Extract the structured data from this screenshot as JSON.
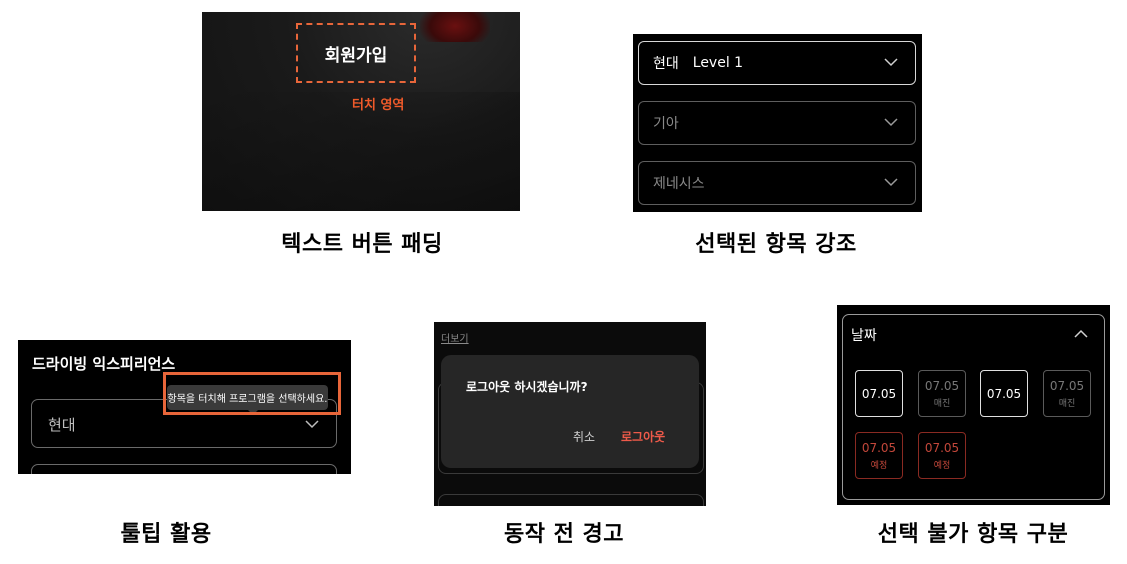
{
  "captions": {
    "text_button_padding": "텍스트 버튼 패딩",
    "selected_item_emphasis": "선택된 항목 강조",
    "tooltip_usage": "툴팁 활용",
    "pre_action_warning": "동작 전 경고",
    "unavailable_item_distinction": "선택 불가 항목 구분"
  },
  "panel_signup": {
    "button_label": "회원가입",
    "touch_area_label": "터치 영역"
  },
  "panel_dropdowns": {
    "items": [
      {
        "label": "현대",
        "sub": "Level 1"
      },
      {
        "label": "기아",
        "sub": ""
      },
      {
        "label": "제네시스",
        "sub": ""
      }
    ]
  },
  "panel_tooltip": {
    "title": "드라이빙 익스피리언스",
    "tooltip_text": "항목을 터치해 프로그램을 선택하세요.",
    "field_value": "현대"
  },
  "panel_dialog": {
    "more_link": "더보기",
    "message": "로그아웃 하시겠습니까?",
    "cancel_label": "취소",
    "logout_label": "로그아웃"
  },
  "panel_dates": {
    "header": "날짜",
    "chips": [
      {
        "date": "07.05",
        "status": ""
      },
      {
        "date": "07.05",
        "status": "매진"
      },
      {
        "date": "07.05",
        "status": ""
      },
      {
        "date": "07.05",
        "status": "매진"
      },
      {
        "date": "07.05",
        "status": "예정"
      },
      {
        "date": "07.05",
        "status": "예정"
      }
    ]
  },
  "colors": {
    "accent_orange": "#e8663a",
    "warning_red": "#ef5a4a"
  }
}
